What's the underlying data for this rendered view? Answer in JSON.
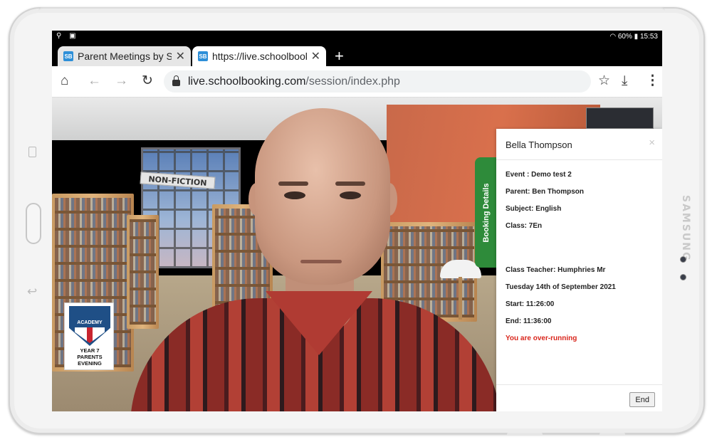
{
  "device": {
    "brand": "SAMSUNG"
  },
  "status_bar": {
    "left_icons": "⚲ ▣",
    "battery": "60%",
    "time": "15:53"
  },
  "browser": {
    "tabs": [
      {
        "favicon": "SB",
        "title": "Parent Meetings by Scho"
      },
      {
        "favicon": "SB",
        "title": "https://live.schoolbooking.com"
      }
    ],
    "new_tab_label": "+",
    "url_host": "live.schoolbooking.com",
    "url_path": "/session/index.php"
  },
  "video": {
    "sign_text": "NON-FICTION",
    "logo": {
      "academy": "ACADEMY",
      "line1": "YEAR 7",
      "line2": "PARENTS",
      "line3": "EVENING"
    }
  },
  "booking": {
    "tab_label": "Booking Details",
    "title": "Bella Thompson",
    "close": "×",
    "event": "Event : Demo test 2",
    "parent": "Parent: Ben Thompson",
    "subject": "Subject: English",
    "class": "Class: 7En",
    "teacher": "Class Teacher: Humphries Mr",
    "date": "Tuesday 14th of September 2021",
    "start": "Start: 11:26:00",
    "end": "End: 11:36:00",
    "warning": "You are over-running",
    "end_button": "End"
  },
  "colors": {
    "warning": "#d9261c",
    "tab_green": "#2e8b3a",
    "favicon_blue": "#2d8fd8"
  }
}
